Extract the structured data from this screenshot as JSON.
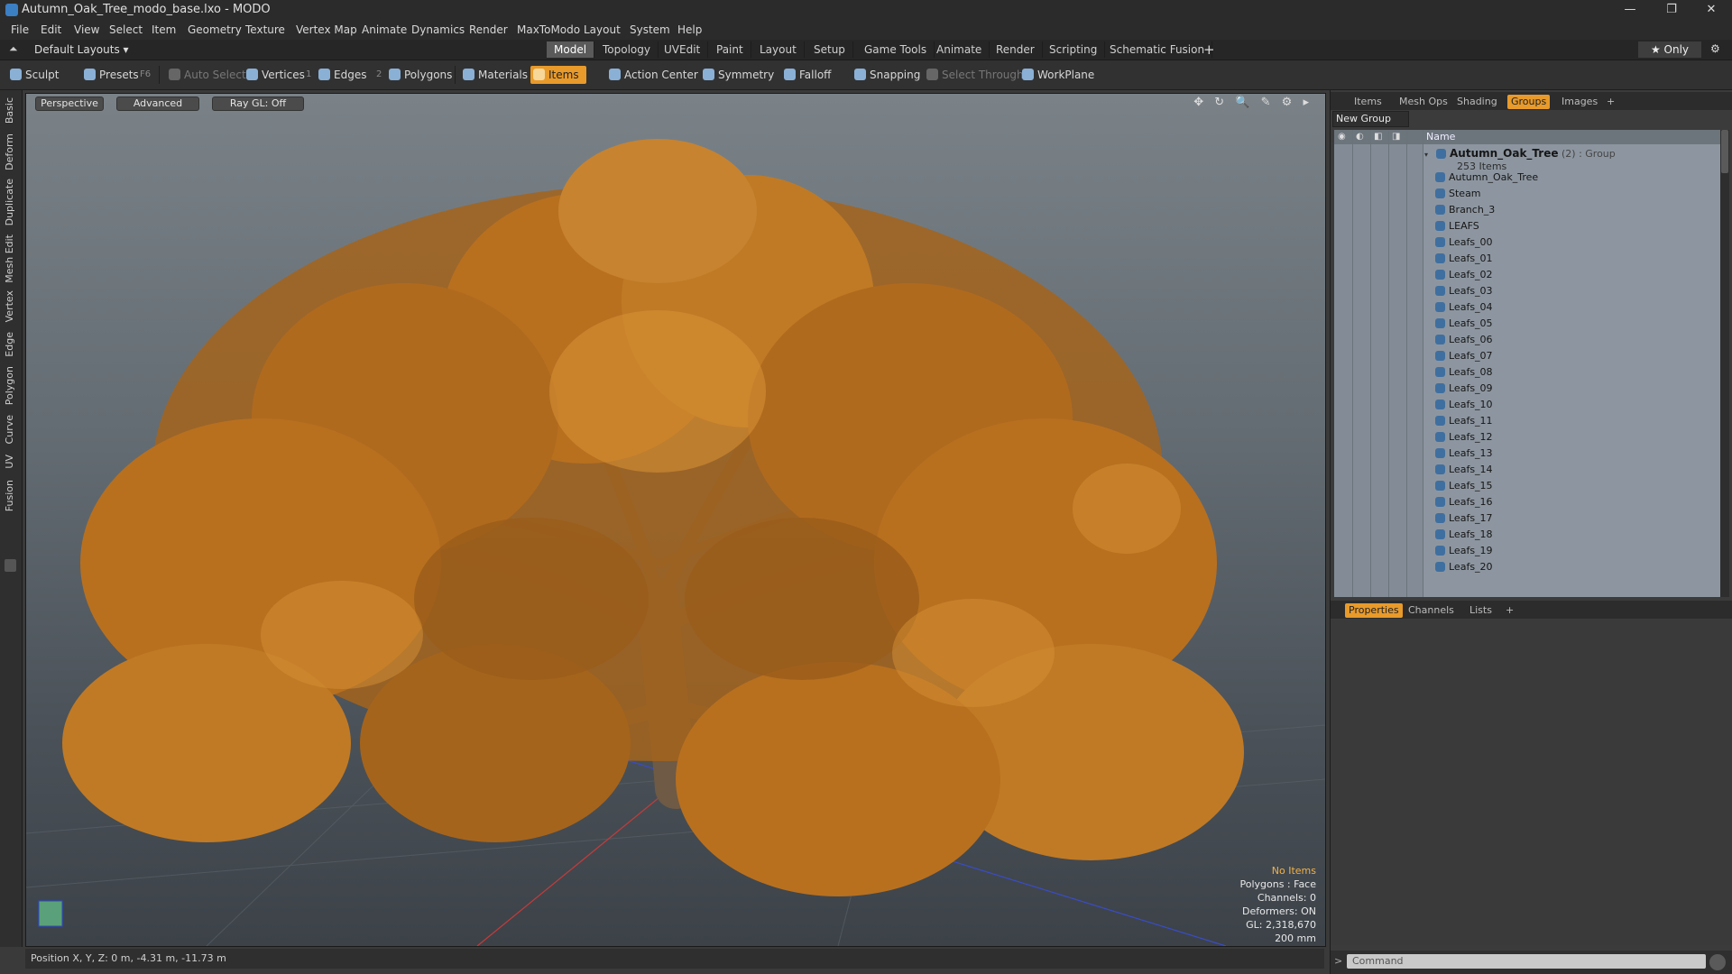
{
  "window": {
    "title": "Autumn_Oak_Tree_modo_base.lxo - MODO",
    "controls": [
      "—",
      "❐",
      "✕"
    ]
  },
  "menu": [
    "File",
    "Edit",
    "View",
    "Select",
    "Item",
    "Geometry",
    "Texture",
    "Vertex Map",
    "Animate",
    "Dynamics",
    "Render",
    "MaxToModo",
    "Layout",
    "System",
    "Help"
  ],
  "layout_bar": {
    "layout_selector": "Default Layouts ▾",
    "tabs": [
      "Model",
      "Topology",
      "UVEdit",
      "Paint",
      "Layout",
      "Setup",
      "Game Tools",
      "Animate",
      "Render",
      "Scripting",
      "Schematic Fusion"
    ],
    "active_tab": "Model",
    "add": "+",
    "only": "★ Only",
    "gear": "⚙"
  },
  "toolbar": {
    "sculpt": "Sculpt",
    "presets": "Presets",
    "presets_key": "F6",
    "auto_select": "Auto Select",
    "vertices": "Vertices",
    "vertices_key": "1",
    "edges": "Edges",
    "edges_key": "2",
    "polygons": "Polygons",
    "materials": "Materials",
    "items": "Items",
    "action_center": "Action Center",
    "symmetry": "Symmetry",
    "falloff": "Falloff",
    "snapping": "Snapping",
    "select_through": "Select Through",
    "workplane": "WorkPlane"
  },
  "left_tabs": [
    "Basic",
    "Deform",
    "Duplicate",
    "Mesh Edit",
    "Vertex",
    "Edge",
    "Polygon",
    "Curve",
    "UV",
    "Fusion"
  ],
  "viewport": {
    "view": "Perspective",
    "shading": "Advanced",
    "raygl": "Ray GL: Off",
    "icons": "✥ ↻ 🔍 ✎ ⚙ ▸",
    "info": {
      "selection": "No Items",
      "polygons": "Polygons : Face",
      "channels": "Channels: 0",
      "deformers": "Deformers: ON",
      "gl": "GL: 2,318,670",
      "scale": "200 mm"
    },
    "colors": {
      "foliage": "#b8701f",
      "foliage_light": "#d69033",
      "trunk": "#6e5a45"
    }
  },
  "status": {
    "position": "Position X, Y, Z:   0 m, -4.31 m, -11.73 m"
  },
  "right_panel": {
    "top_tabs": [
      "Items",
      "Mesh Ops",
      "Shading",
      "Groups",
      "Images",
      "+"
    ],
    "active_top_tab": "Groups",
    "new_group": "New Group",
    "column_name": "Name",
    "group": {
      "name": "Autumn_Oak_Tree",
      "suffix": " (2) : Group",
      "count": "253 Items"
    },
    "items": [
      "Autumn_Oak_Tree",
      "Steam",
      "Branch_3",
      "LEAFS",
      "Leafs_00",
      "Leafs_01",
      "Leafs_02",
      "Leafs_03",
      "Leafs_04",
      "Leafs_05",
      "Leafs_06",
      "Leafs_07",
      "Leafs_08",
      "Leafs_09",
      "Leafs_10",
      "Leafs_11",
      "Leafs_12",
      "Leafs_13",
      "Leafs_14",
      "Leafs_15",
      "Leafs_16",
      "Leafs_17",
      "Leafs_18",
      "Leafs_19",
      "Leafs_20"
    ],
    "bottom_tabs": [
      "Properties",
      "Channels",
      "Lists",
      "+"
    ],
    "active_bottom_tab": "Properties",
    "command_placeholder": "Command"
  }
}
